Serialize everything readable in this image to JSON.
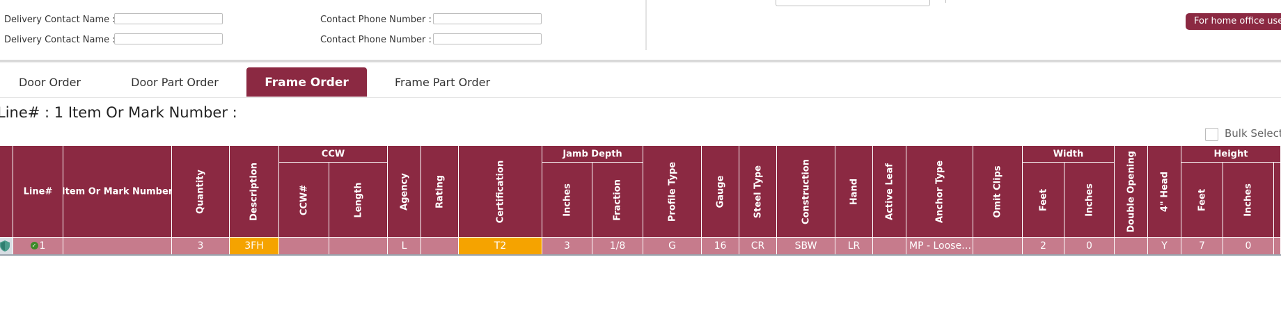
{
  "contacts": {
    "row1": {
      "name_label": "Delivery Contact Name :",
      "name_value": "",
      "phone_label": "Contact Phone Number :",
      "phone_value": ""
    },
    "row2": {
      "name_label": "Delivery Contact Name :",
      "name_value": "",
      "phone_label": "Contact Phone Number :",
      "phone_value": ""
    }
  },
  "home_office_button": "For home office use",
  "tabs": [
    {
      "label": "Door Order",
      "active": false
    },
    {
      "label": "Door Part Order",
      "active": false
    },
    {
      "label": "Frame Order",
      "active": true
    },
    {
      "label": "Frame Part Order",
      "active": false
    }
  ],
  "line_title": "Line# : 1 Item Or Mark Number :",
  "bulk_select_label": "Bulk Select",
  "colors": {
    "accent": "#8b2942",
    "row": "#c67b8c",
    "warning": "#f5a300",
    "ok": "#3d8a27"
  },
  "table": {
    "groups": {
      "ccw": "CCW",
      "jamb_depth": "Jamb Depth",
      "width": "Width",
      "height": "Height"
    },
    "headers": {
      "line": "Line#",
      "item": "Item Or Mark Number",
      "quantity": "Quantity",
      "description": "Description",
      "ccw_num": "CCW#",
      "ccw_length": "Length",
      "agency": "Agency",
      "rating": "Rating",
      "certification": "Certification",
      "jamb_inches": "Inches",
      "jamb_fraction": "Fraction",
      "profile_type": "Profile Type",
      "gauge": "Gauge",
      "steel_type": "Steel Type",
      "construction": "Construction",
      "hand": "Hand",
      "active_leaf": "Active Leaf",
      "anchor_type": "Anchor Type",
      "omit_clips": "Omit Clips",
      "width_feet": "Feet",
      "width_inches": "Inches",
      "double_opening": "Double Opening",
      "head": "4\" Head",
      "height_feet": "Feet",
      "height_inches": "Inches"
    },
    "rows": [
      {
        "status_icon": "shield-icon",
        "check_icon": "check-icon",
        "line": "1",
        "item": "",
        "quantity": "3",
        "description": "3FH",
        "ccw_num": "",
        "ccw_length": "",
        "agency": "L",
        "rating": "",
        "certification": "T2",
        "jamb_inches": "3",
        "jamb_fraction": "1/8",
        "profile_type": "G",
        "gauge": "16",
        "steel_type": "CR",
        "construction": "SBW",
        "hand": "LR",
        "active_leaf": "",
        "anchor_type": "MP - Loose, Masonry Anchor",
        "omit_clips": "",
        "width_feet": "2",
        "width_inches": "0",
        "double_opening": "",
        "head": "Y",
        "height_feet": "7",
        "height_inches": "0"
      }
    ]
  }
}
